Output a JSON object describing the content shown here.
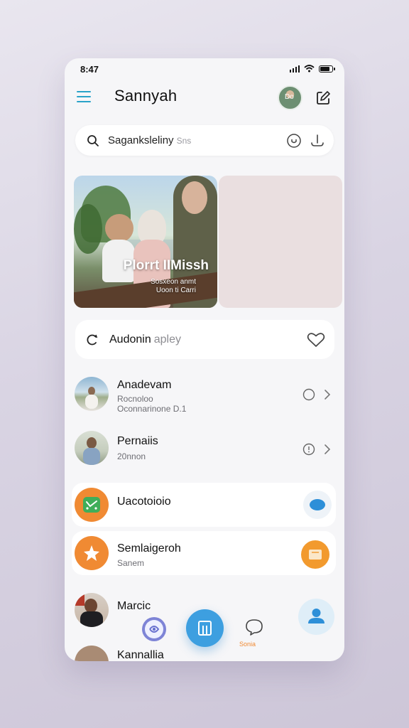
{
  "status": {
    "time": "8:47"
  },
  "header": {
    "title": "Sannyah",
    "avatar_text": "Do"
  },
  "search": {
    "text": "Saganksleliny",
    "hint": "Sns"
  },
  "carousel": {
    "title": "Plorrt IIMissh",
    "subtitle_line1": "Sosxeon anmt",
    "subtitle_line2": "Uoon ti Carri"
  },
  "audio": {
    "label": "Audonin",
    "sub": "apley"
  },
  "list": [
    {
      "name": "Anadevam",
      "sub1": "Rocnoloo",
      "sub2": "Oconnarinone D.1"
    },
    {
      "name": "Pernaiis",
      "sub1": "20nnon"
    }
  ],
  "cards": [
    {
      "name": "Uacotoioio",
      "icon_color": "#f08a33",
      "badge_color": "#2d8fd8"
    },
    {
      "name": "Semlaigeroh",
      "sub": "Sanem",
      "badge_color": "#f29a2e"
    }
  ],
  "more": [
    {
      "name": "Marcic"
    },
    {
      "name": "Kannallia"
    }
  ],
  "nav": {
    "label": "Sonia"
  },
  "colors": {
    "accent": "#2aa3c9",
    "orange": "#f08a33",
    "blue": "#3d9fe0",
    "phone_bg": "#f6f6f8"
  }
}
